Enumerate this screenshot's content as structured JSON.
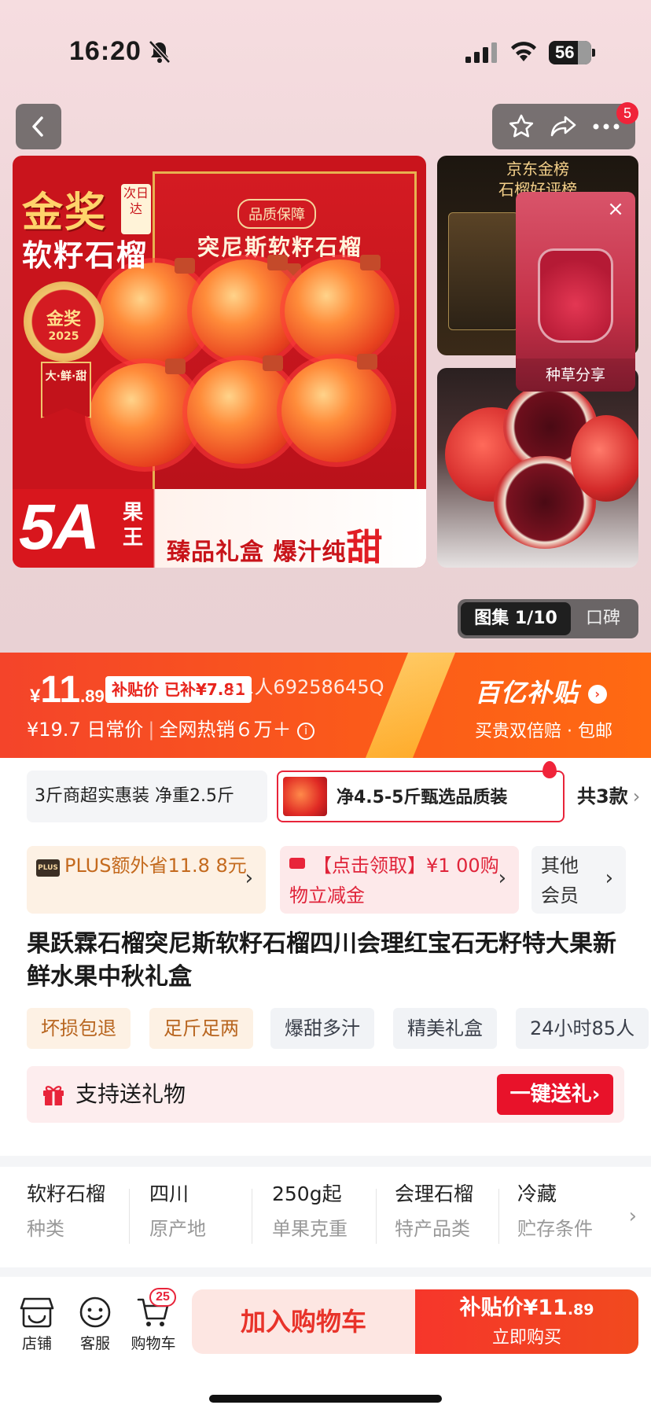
{
  "status_bar": {
    "time": "16:20",
    "battery": "56",
    "icons": [
      "bell-off-icon",
      "signal-icon",
      "wifi-icon",
      "battery-icon"
    ]
  },
  "top_nav": {
    "back_icon": "chevron-left-icon",
    "actions": [
      "star-icon",
      "share-icon",
      "more-icon"
    ],
    "message_badge": "5"
  },
  "hero_image": {
    "headline_gold": "金奖",
    "next_day": "次日达",
    "headline_sub": "软籽石榴",
    "seal_text": "金奖",
    "seal_year": "2025",
    "seal_ribbon": "大·鲜·甜",
    "quality_tag": "品质保障",
    "box_title": "突尼斯软籽石榴",
    "five_a": "5A",
    "fruit_king": "果王",
    "tagline": "臻品礼盒 爆汁纯",
    "tagline_sweet": "甜",
    "thumb_rank_title": "京东金榜",
    "thumb_rank_sub": "石榴好评榜"
  },
  "video_card": {
    "label": "种草分享",
    "close": "×"
  },
  "gallery": {
    "album": "图集 1/10",
    "reviews": "口碑"
  },
  "price": {
    "currency": "¥",
    "integer": "11",
    "cents": ".89",
    "subsidy_label": "补贴价 已补¥7.81",
    "overlay_text": "7.51人69258645Q",
    "original_price": "¥19.7",
    "daily_label": "日常价",
    "sales": "全网热销６万＋",
    "brand": "百亿补贴",
    "brand_sub": "买贵双倍赔 · 包邮",
    "colors": {
      "band_start": "#f4442a",
      "band_end": "#ff6a12"
    }
  },
  "variants": {
    "items": [
      "3斤商超实惠装 净重2.5斤",
      "净4.5-5斤甄选品质装"
    ],
    "count": "共3款"
  },
  "promos": {
    "plus_badge": "PLUS",
    "plus_text": "PLUS额外省11.8 8元",
    "coupon_text": "【点击领取】¥1 00购物立减金",
    "member_text": "其他 会员"
  },
  "product_title": "果跃霖石榴突尼斯软籽石榴四川会理红宝石无籽特大果新鲜水果中秋礼盒",
  "tags": [
    "坏损包退",
    "足斤足两",
    "爆甜多汁",
    "精美礼盒",
    "24小时85人"
  ],
  "gift": {
    "text": "支持送礼物",
    "button": "一键送礼"
  },
  "specs": [
    {
      "value": "软籽石榴",
      "key": "种类"
    },
    {
      "value": "四川",
      "key": "原产地"
    },
    {
      "value": "250g起",
      "key": "单果克重"
    },
    {
      "value": "会理石榴",
      "key": "特产品类"
    },
    {
      "value": "冷藏",
      "key": "贮存条件"
    }
  ],
  "bottom_bar": {
    "store": "店铺",
    "service": "客服",
    "cart": "购物车",
    "cart_badge": "25",
    "add_to_cart": "加入购物车",
    "buy_price_label": "补贴价¥11",
    "buy_price_cents": ".89",
    "buy_now": "立即购买"
  }
}
